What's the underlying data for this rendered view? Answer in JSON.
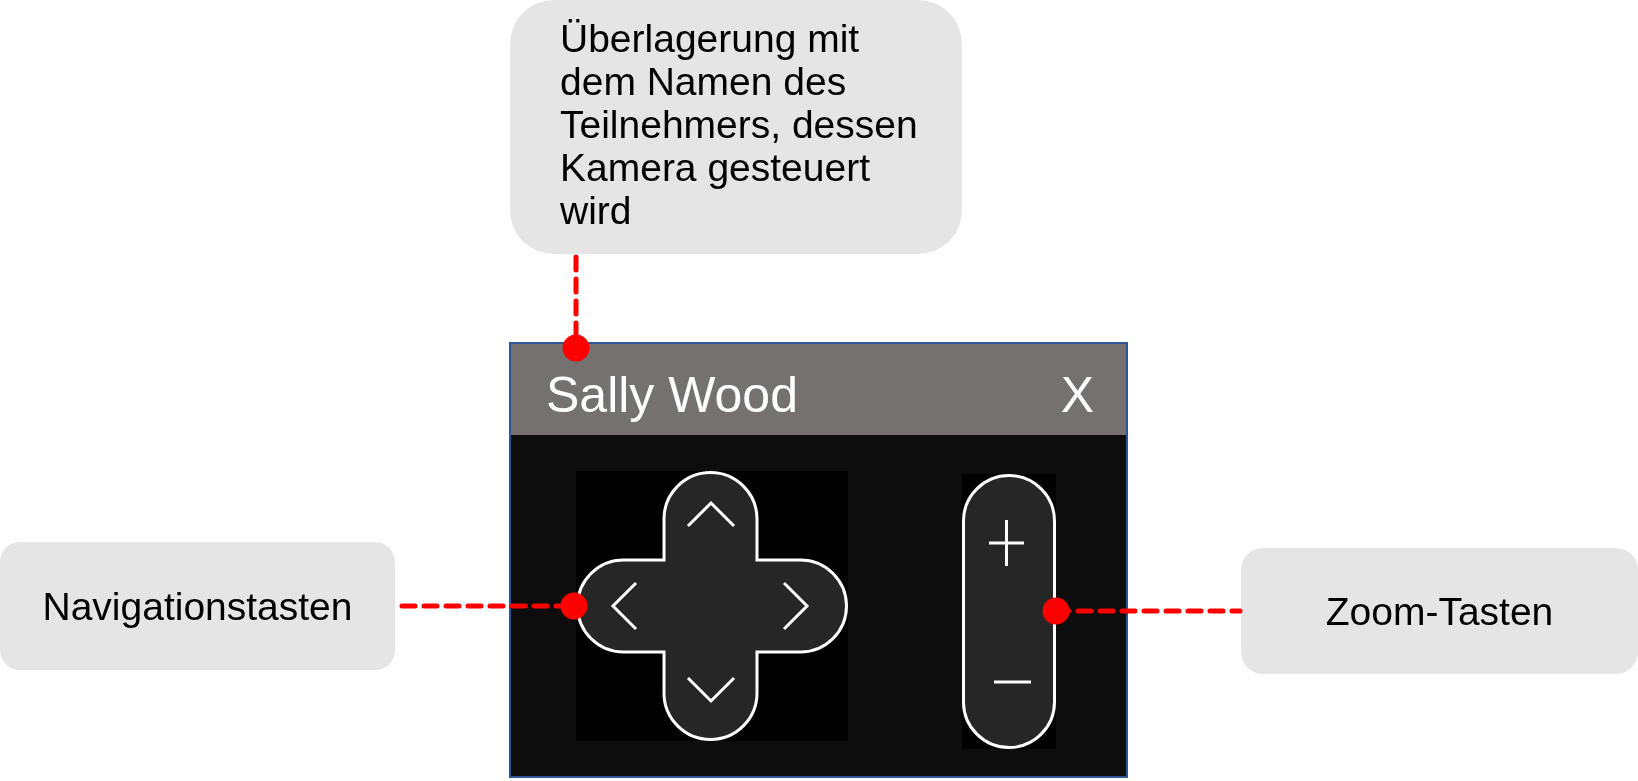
{
  "callouts": [
    {
      "text": "Überlagerung mit dem Namen des Teilnehmers, dessen Kamera gesteuert wird"
    },
    {
      "text": "Navigationstasten"
    },
    {
      "text": "Zoom-Tasten"
    }
  ],
  "window": {
    "title": "Sally Wood",
    "close": "X"
  }
}
